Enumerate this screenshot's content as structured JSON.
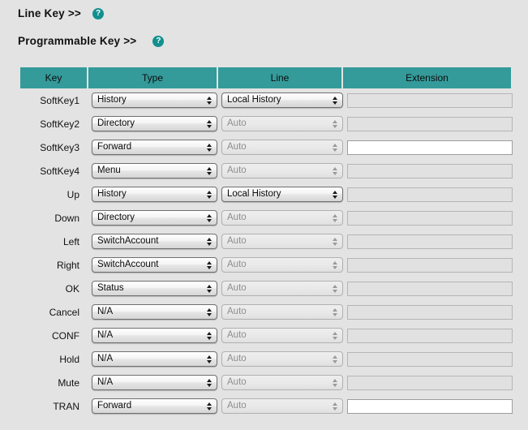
{
  "sections": {
    "line_key": {
      "label": "Line Key >>",
      "help_icon": "help-question-icon",
      "help_glyph": "?"
    },
    "programmable_key": {
      "label": "Programmable Key >>",
      "help_icon": "help-question-icon",
      "help_glyph": "?"
    }
  },
  "table": {
    "headers": [
      "Key",
      "Type",
      "Line",
      "Extension"
    ],
    "header_bg": "#349a9a",
    "accent": "#11908f",
    "page_bg": "#e3e3e3",
    "rows": [
      {
        "key": "SoftKey1",
        "type": "History",
        "type_enabled": true,
        "line": "Local History",
        "line_enabled": true,
        "extension": "",
        "extension_enabled": false
      },
      {
        "key": "SoftKey2",
        "type": "Directory",
        "type_enabled": true,
        "line": "Auto",
        "line_enabled": false,
        "extension": "",
        "extension_enabled": false
      },
      {
        "key": "SoftKey3",
        "type": "Forward",
        "type_enabled": true,
        "line": "Auto",
        "line_enabled": false,
        "extension": "",
        "extension_enabled": true
      },
      {
        "key": "SoftKey4",
        "type": "Menu",
        "type_enabled": true,
        "line": "Auto",
        "line_enabled": false,
        "extension": "",
        "extension_enabled": false
      },
      {
        "key": "Up",
        "type": "History",
        "type_enabled": true,
        "line": "Local History",
        "line_enabled": true,
        "extension": "",
        "extension_enabled": false
      },
      {
        "key": "Down",
        "type": "Directory",
        "type_enabled": true,
        "line": "Auto",
        "line_enabled": false,
        "extension": "",
        "extension_enabled": false
      },
      {
        "key": "Left",
        "type": "SwitchAccount",
        "type_enabled": true,
        "line": "Auto",
        "line_enabled": false,
        "extension": "",
        "extension_enabled": false
      },
      {
        "key": "Right",
        "type": "SwitchAccount",
        "type_enabled": true,
        "line": "Auto",
        "line_enabled": false,
        "extension": "",
        "extension_enabled": false
      },
      {
        "key": "OK",
        "type": "Status",
        "type_enabled": true,
        "line": "Auto",
        "line_enabled": false,
        "extension": "",
        "extension_enabled": false
      },
      {
        "key": "Cancel",
        "type": "N/A",
        "type_enabled": true,
        "line": "Auto",
        "line_enabled": false,
        "extension": "",
        "extension_enabled": false
      },
      {
        "key": "CONF",
        "type": "N/A",
        "type_enabled": true,
        "line": "Auto",
        "line_enabled": false,
        "extension": "",
        "extension_enabled": false
      },
      {
        "key": "Hold",
        "type": "N/A",
        "type_enabled": true,
        "line": "Auto",
        "line_enabled": false,
        "extension": "",
        "extension_enabled": false
      },
      {
        "key": "Mute",
        "type": "N/A",
        "type_enabled": true,
        "line": "Auto",
        "line_enabled": false,
        "extension": "",
        "extension_enabled": false
      },
      {
        "key": "TRAN",
        "type": "Forward",
        "type_enabled": true,
        "line": "Auto",
        "line_enabled": false,
        "extension": "",
        "extension_enabled": true
      }
    ]
  }
}
